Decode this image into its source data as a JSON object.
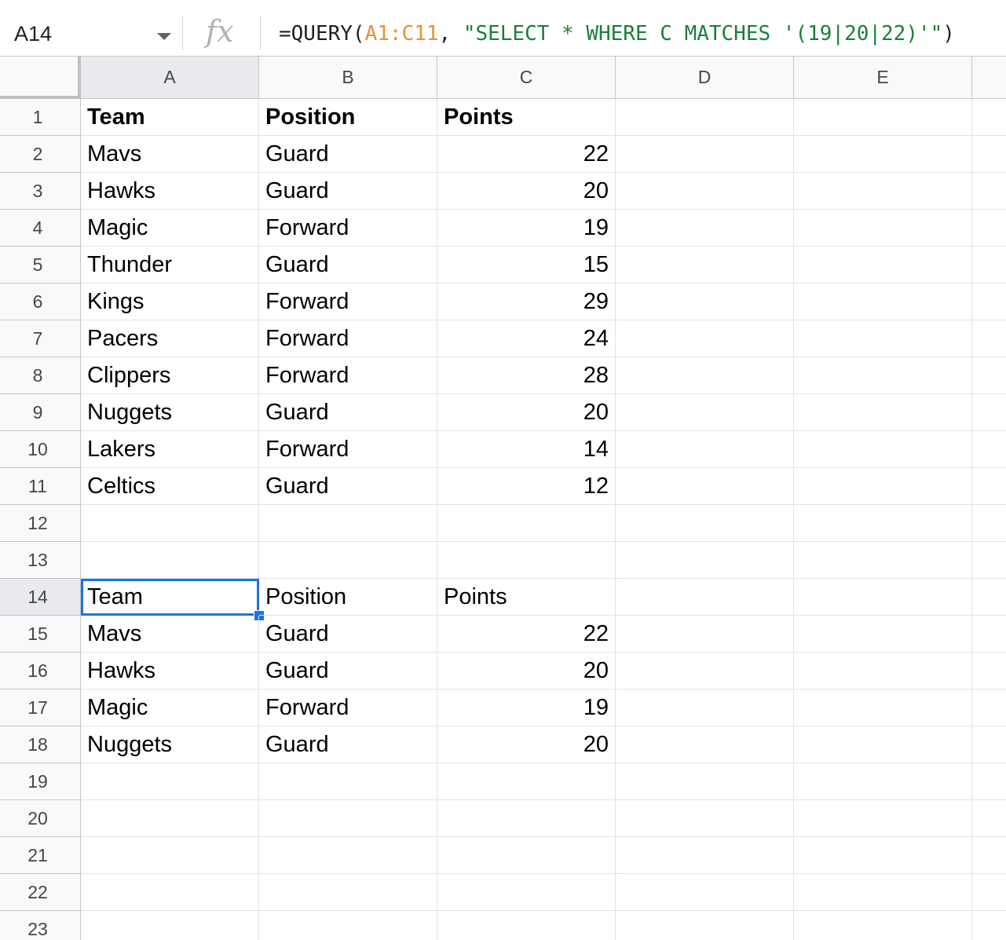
{
  "formula_bar": {
    "name_box": "A14",
    "fx_label": "fx",
    "formula_prefix": "=QUERY(",
    "formula_range": "A1:C11",
    "formula_sep": ", ",
    "formula_string": "\"SELECT * WHERE C MATCHES '(19|20|22)'\"",
    "formula_suffix": ")"
  },
  "columns": [
    "A",
    "B",
    "C",
    "D",
    "E"
  ],
  "selected_cell": "A14",
  "rows": [
    {
      "n": "1",
      "cells": [
        "Team",
        "Position",
        "Points"
      ],
      "bold": true,
      "numeric_c": false
    },
    {
      "n": "2",
      "cells": [
        "Mavs",
        "Guard",
        "22"
      ]
    },
    {
      "n": "3",
      "cells": [
        "Hawks",
        "Guard",
        "20"
      ]
    },
    {
      "n": "4",
      "cells": [
        "Magic",
        "Forward",
        "19"
      ]
    },
    {
      "n": "5",
      "cells": [
        "Thunder",
        "Guard",
        "15"
      ]
    },
    {
      "n": "6",
      "cells": [
        "Kings",
        "Forward",
        "29"
      ]
    },
    {
      "n": "7",
      "cells": [
        "Pacers",
        "Forward",
        "24"
      ]
    },
    {
      "n": "8",
      "cells": [
        "Clippers",
        "Forward",
        "28"
      ]
    },
    {
      "n": "9",
      "cells": [
        "Nuggets",
        "Guard",
        "20"
      ]
    },
    {
      "n": "10",
      "cells": [
        "Lakers",
        "Forward",
        "14"
      ]
    },
    {
      "n": "11",
      "cells": [
        "Celtics",
        "Guard",
        "12"
      ]
    },
    {
      "n": "12",
      "cells": [
        "",
        "",
        ""
      ]
    },
    {
      "n": "13",
      "cells": [
        "",
        "",
        ""
      ]
    },
    {
      "n": "14",
      "cells": [
        "Team",
        "Position",
        "Points"
      ],
      "numeric_c": false
    },
    {
      "n": "15",
      "cells": [
        "Mavs",
        "Guard",
        "22"
      ]
    },
    {
      "n": "16",
      "cells": [
        "Hawks",
        "Guard",
        "20"
      ]
    },
    {
      "n": "17",
      "cells": [
        "Magic",
        "Forward",
        "19"
      ]
    },
    {
      "n": "18",
      "cells": [
        "Nuggets",
        "Guard",
        "20"
      ]
    },
    {
      "n": "19",
      "cells": [
        "",
        "",
        ""
      ]
    },
    {
      "n": "20",
      "cells": [
        "",
        "",
        ""
      ]
    },
    {
      "n": "21",
      "cells": [
        "",
        "",
        ""
      ]
    },
    {
      "n": "22",
      "cells": [
        "",
        "",
        ""
      ]
    },
    {
      "n": "23",
      "cells": [
        "",
        "",
        ""
      ]
    }
  ]
}
